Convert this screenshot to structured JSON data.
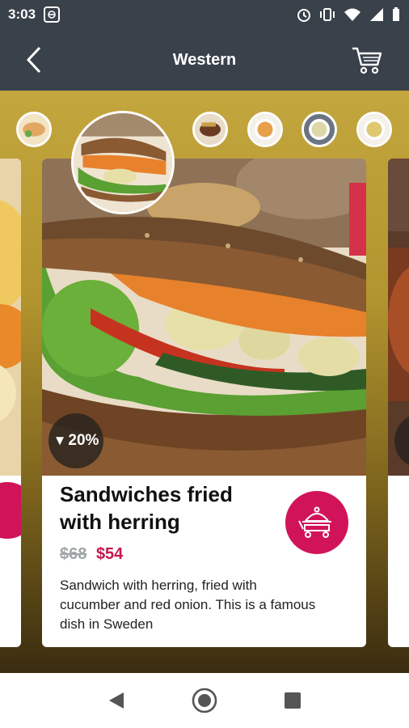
{
  "status_bar": {
    "time": "3:03",
    "icons": [
      "app-icon",
      "alarm-icon",
      "vibrate-icon",
      "wifi-icon",
      "signal-icon",
      "battery-icon"
    ]
  },
  "app_bar": {
    "title": "Western",
    "back_icon": "chevron-left-icon",
    "cart_icon": "cart-icon"
  },
  "category_thumbs": [
    {
      "name": "wrap-dish"
    },
    {
      "name": "sandwich",
      "selected": true
    },
    {
      "name": "steak"
    },
    {
      "name": "curry-soup"
    },
    {
      "name": "cream-soup"
    },
    {
      "name": "potato-soup"
    }
  ],
  "card": {
    "title": "Sandwiches fried with herring",
    "discount": "20%",
    "old_price": "$68",
    "new_price": "$54",
    "description": "Sandwich with herring, fried with cucumber and red onion. This is a famous dish in Sweden",
    "order_icon": "food-cart-icon"
  },
  "colors": {
    "app_bar": "#39414a",
    "accent": "#d1145a",
    "price_new": "#c6174a",
    "background_top": "#c4a63e"
  },
  "nav_bar": {
    "back_icon": "nav-back-icon",
    "home_icon": "nav-home-icon",
    "recents_icon": "nav-recents-icon"
  }
}
